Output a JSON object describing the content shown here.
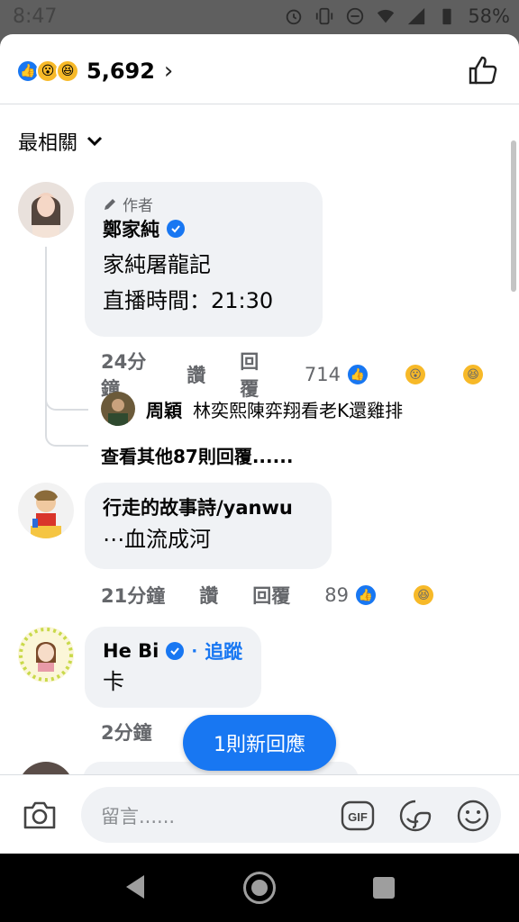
{
  "status_bar": {
    "time": "8:47",
    "battery": "58%"
  },
  "header": {
    "reaction_count": "5,692",
    "reactions": [
      "like",
      "wow",
      "haha"
    ]
  },
  "sort": {
    "label": "最相關"
  },
  "comments": [
    {
      "author_tag": "作者",
      "name": "鄭家純",
      "verified": true,
      "text_lines": [
        "家純屠龍記",
        "直播時間：21:30"
      ],
      "time": "24分鐘",
      "like_label": "讚",
      "reply_label": "回覆",
      "reaction_count": "714",
      "reply_preview": {
        "name": "周穎",
        "text": "林奕熙陳弈翔看老K還雞排"
      },
      "more_replies": "查看其他87則回覆......"
    },
    {
      "name": "行走的故事詩/yanwu",
      "text_lines": [
        "⋯血流成河"
      ],
      "time": "21分鐘",
      "like_label": "讚",
      "reply_label": "回覆",
      "reaction_count": "89"
    },
    {
      "name": "He Bi",
      "verified": true,
      "follow_dot": "·",
      "follow_label": "追蹤",
      "text_lines": [
        "卡"
      ],
      "time": "2分鐘"
    }
  ],
  "new_reply_pill": "1則新回應",
  "composer": {
    "placeholder": "留言......"
  },
  "colors": {
    "accent": "#1877f2",
    "bubble": "#f0f2f5",
    "meta": "#65676b"
  }
}
